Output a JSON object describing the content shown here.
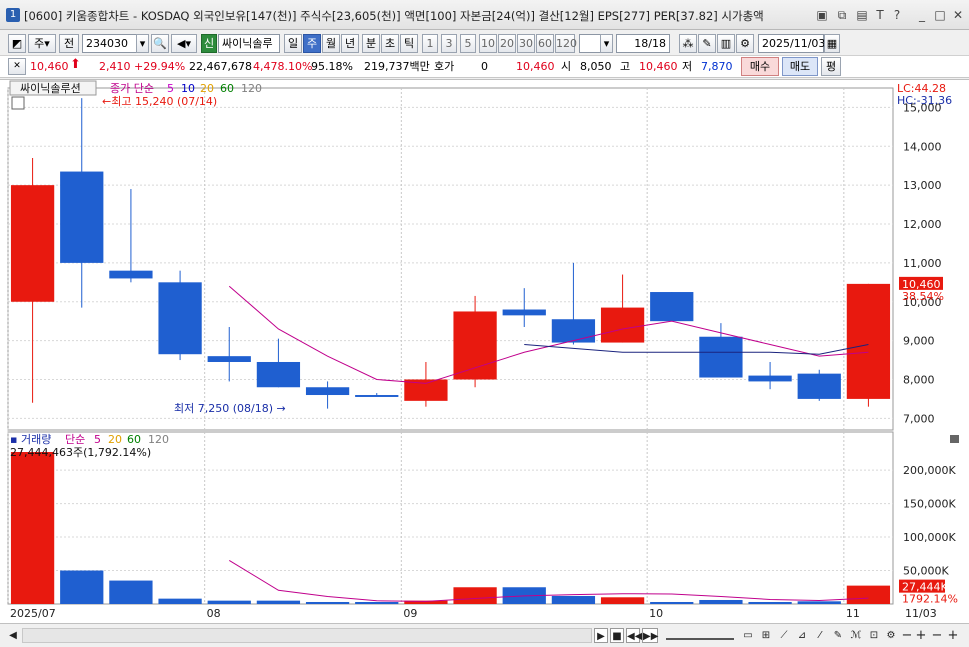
{
  "window": {
    "badge": "1",
    "title": "[0600] 키움종합차트 - KOSDAQ 외국인보유[147(천)] 주식수[23,605(천)] 액면[100] 자본금[24(억)] 결산[12월] EPS[277] PER[37.82] 시가총액",
    "icons": [
      "restore-icon",
      "window-icon",
      "stack-icon",
      "font-icon",
      "help-icon",
      "minimize-icon",
      "maximize-icon",
      "close-icon"
    ]
  },
  "toolbar": {
    "period_unit": "주",
    "prev_label": "전",
    "code": "234030",
    "new_badge": "신",
    "stock_name": "싸이닉솔루",
    "tabs": [
      "일",
      "주",
      "월",
      "년",
      "분",
      "초",
      "틱"
    ],
    "active_tab": "주",
    "intervals": [
      "1",
      "3",
      "5",
      "10",
      "20",
      "30",
      "60",
      "120"
    ],
    "count": "18/18",
    "date": "2025/11/03"
  },
  "quote": {
    "price": "10,460",
    "change": "2,410",
    "change_pct": "+29.94%",
    "volume": "22,467,678",
    "volume_pct": "4,478.10%",
    "ratio": "95.18%",
    "amount": "219,737백만",
    "hoga_label": "호가",
    "hoga_value": "0",
    "hoga_price": "10,460",
    "open_label": "시",
    "open": "8,050",
    "high_label": "고",
    "high": "10,460",
    "low_label": "저",
    "low": "7,870",
    "buy_label": "매수",
    "sell_label": "매도",
    "avg_label": "평"
  },
  "price_panel": {
    "stock_tag": "싸이닉솔루션",
    "ma_title": "종가 단순",
    "ma_periods": [
      "5",
      "10",
      "20",
      "60",
      "120"
    ],
    "ma_colors": [
      "#c800c8",
      "#0000c8",
      "#e0a000",
      "#008000",
      "#808080"
    ],
    "lc_label": "LC:44.28",
    "hc_label": "HC:-31.36",
    "high_annotation": "최고 15,240 (07/14)",
    "low_annotation": "최저 7,250 (08/18)",
    "current_price_tag": "10,460",
    "current_pct_tag": "38.54%"
  },
  "volume_panel": {
    "title": "거래량",
    "ma_title": "단순",
    "ma_periods": [
      "5",
      "20",
      "60",
      "120"
    ],
    "first_bar_label": "27,444,463주(1,792.14%)",
    "current_tag": "27,444K",
    "current_pct_tag": "1792.14%"
  },
  "colors": {
    "up": "#e8190f",
    "down": "#1f5fd0",
    "ma5": "#c0008c",
    "ma10": "#1a237e"
  },
  "chart_data": {
    "type": "candlestick",
    "price_ticks": [
      "15,000",
      "14,000",
      "13,000",
      "12,000",
      "11,000",
      "10,000",
      "9,000",
      "8,000",
      "7,000"
    ],
    "volume_ticks": [
      "200,000K",
      "150,000K",
      "100,000K",
      "50,000K"
    ],
    "x_labels": [
      "2025/07",
      "08",
      "09",
      "10",
      "11",
      "11/03"
    ],
    "candles": [
      {
        "o": 10000,
        "h": 13700,
        "l": 7400,
        "c": 13000
      },
      {
        "o": 13350,
        "h": 15240,
        "l": 9850,
        "c": 11000
      },
      {
        "o": 10800,
        "h": 12900,
        "l": 10500,
        "c": 10600
      },
      {
        "o": 10500,
        "h": 10800,
        "l": 8500,
        "c": 8650
      },
      {
        "o": 8600,
        "h": 9350,
        "l": 7950,
        "c": 8450
      },
      {
        "o": 8450,
        "h": 9050,
        "l": 7800,
        "c": 7800
      },
      {
        "o": 7800,
        "h": 7950,
        "l": 7250,
        "c": 7600
      },
      {
        "o": 7600,
        "h": 7650,
        "l": 7600,
        "c": 7550
      },
      {
        "o": 7450,
        "h": 8450,
        "l": 7300,
        "c": 8000
      },
      {
        "o": 8000,
        "h": 10150,
        "l": 7800,
        "c": 9750
      },
      {
        "o": 9800,
        "h": 10350,
        "l": 9350,
        "c": 9650
      },
      {
        "o": 9550,
        "h": 11000,
        "l": 8900,
        "c": 8950
      },
      {
        "o": 8950,
        "h": 10700,
        "l": 8950,
        "c": 9850
      },
      {
        "o": 10250,
        "h": 10250,
        "l": 9500,
        "c": 9500
      },
      {
        "o": 9100,
        "h": 9450,
        "l": 8050,
        "c": 8050
      },
      {
        "o": 8100,
        "h": 8450,
        "l": 7750,
        "c": 7950
      },
      {
        "o": 8150,
        "h": 8250,
        "l": 7450,
        "c": 7500
      },
      {
        "o": 7500,
        "h": 10460,
        "l": 7300,
        "c": 10460
      }
    ],
    "ma5": [
      null,
      null,
      null,
      null,
      10400,
      9300,
      8600,
      8000,
      7900,
      8300,
      8700,
      9000,
      9300,
      9500,
      9200,
      8900,
      8600,
      8700
    ],
    "ma10": [
      null,
      null,
      null,
      null,
      null,
      null,
      null,
      null,
      null,
      null,
      8900,
      8800,
      8700,
      8700,
      8700,
      8700,
      8650,
      8900
    ],
    "volumes": [
      227000,
      50000,
      35000,
      8000,
      5000,
      5000,
      3000,
      3000,
      5000,
      25000,
      25000,
      12000,
      10000,
      3000,
      6000,
      3000,
      4000,
      27444
    ],
    "vol_ma5": [
      null,
      null,
      null,
      null,
      65000,
      20500,
      11200,
      4800,
      4000,
      8200,
      12200,
      14000,
      15400,
      15000,
      11200,
      6800,
      5200,
      8700
    ]
  }
}
